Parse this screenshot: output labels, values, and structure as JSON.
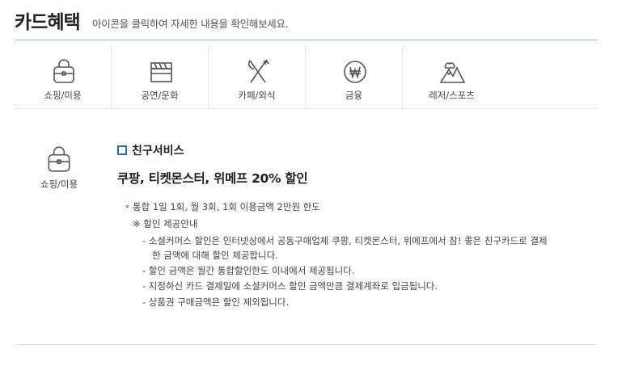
{
  "header": {
    "title": "카드혜택",
    "subtitle": "아이콘을 클릭하여 자세한 내용을 확인해보세요."
  },
  "categories": [
    {
      "label": "쇼핑/미용",
      "icon": "handbag-icon"
    },
    {
      "label": "공연/문화",
      "icon": "clapperboard-icon"
    },
    {
      "label": "카페/외식",
      "icon": "fork-knife-icon"
    },
    {
      "label": "금융",
      "icon": "won-coin-icon"
    },
    {
      "label": "레저/스포츠",
      "icon": "mountain-icon"
    }
  ],
  "selected": {
    "label": "쇼핑/미용",
    "icon": "handbag-icon"
  },
  "service": {
    "name": "친구서비스",
    "headline": "쿠팡, 티켓몬스터, 위메프 20% 할인",
    "limit": "통합 1일 1회, 월 3회, 1회 이용금액 2만원 한도",
    "notice_title": "※ 할인 제공안내",
    "notes": [
      "- 소셜커머스 할인은 인터넷상에서 공동구매업체 쿠팡, 티켓몬스터, 위메프에서 참! 좋은 친구카드로 결제",
      "한 금액에 대해 할인 제공합니다.",
      "- 할인 금액은 월간 통합할인한도 이내에서 제공됩니다.",
      "- 지정하신 카드 결제일에 소셜커머스 할인 금액만큼 결제계좌로 입금됩니다.",
      "- 상품권 구매금액은 할인 제외됩니다."
    ]
  },
  "colors": {
    "accent": "#1f6fc9",
    "header_rule": "#9bbfc7",
    "text": "#333333"
  }
}
